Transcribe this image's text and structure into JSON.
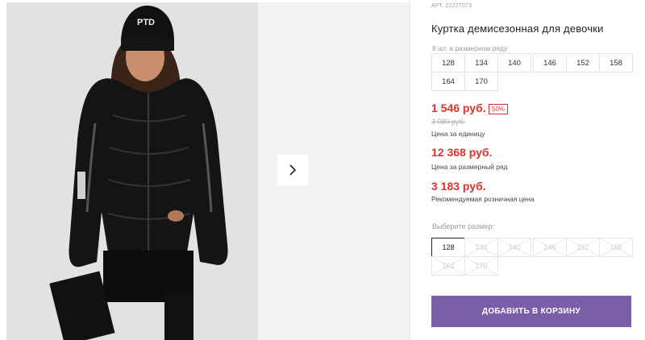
{
  "product": {
    "article": "АРТ. 22227073",
    "title": "Куртка демисезонная для девочки",
    "range_caption": "8 шт. в размерном ряду",
    "sizes": [
      "128",
      "134",
      "140",
      "146",
      "152",
      "158",
      "164",
      "170"
    ]
  },
  "pricing": {
    "unit_price": "1 546 руб.",
    "discount": "50%",
    "old_price": "3 080 руб.",
    "unit_price_label": "Цена за единицу",
    "range_price": "12 368 руб.",
    "range_price_label": "Цена за размерный ряд",
    "retail_price": "3 183 руб.",
    "retail_price_label": "Рекомендуемая розничная цена"
  },
  "size_selector": {
    "label": "Выберите размер:",
    "selected": "128",
    "options": [
      "128",
      "134",
      "140",
      "146",
      "152",
      "158",
      "164",
      "170"
    ]
  },
  "actions": {
    "add_to_cart": "ДОБАВИТЬ В КОРЗИНУ"
  },
  "gallery": {
    "hat_text": "PTD",
    "next_icon": "chevron-right-icon"
  },
  "colors": {
    "price_red": "#e03030",
    "button_purple": "#7a5ea8"
  }
}
